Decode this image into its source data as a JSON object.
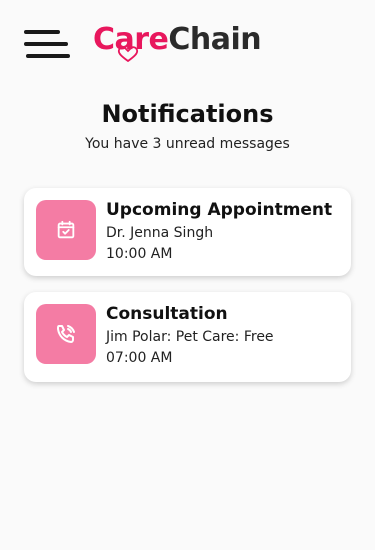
{
  "header": {
    "logo_part1": "Care",
    "logo_part2": "Chain",
    "menu_icon": "hamburger-menu-icon",
    "brand_color": "#e8175d"
  },
  "page": {
    "title": "Notifications",
    "subtitle": "You have 3 unread messages"
  },
  "notifications": [
    {
      "icon": "calendar-check-icon",
      "title": "Upcoming Appointment",
      "line1": "Dr. Jenna Singh",
      "line2": "10:00 AM"
    },
    {
      "icon": "phone-call-icon",
      "title": "Consultation",
      "line1": "Jim Polar: Pet Care: Free",
      "line2": "07:00 AM"
    }
  ],
  "colors": {
    "icon_bg": "#f47ca4",
    "background": "#fafafa"
  }
}
